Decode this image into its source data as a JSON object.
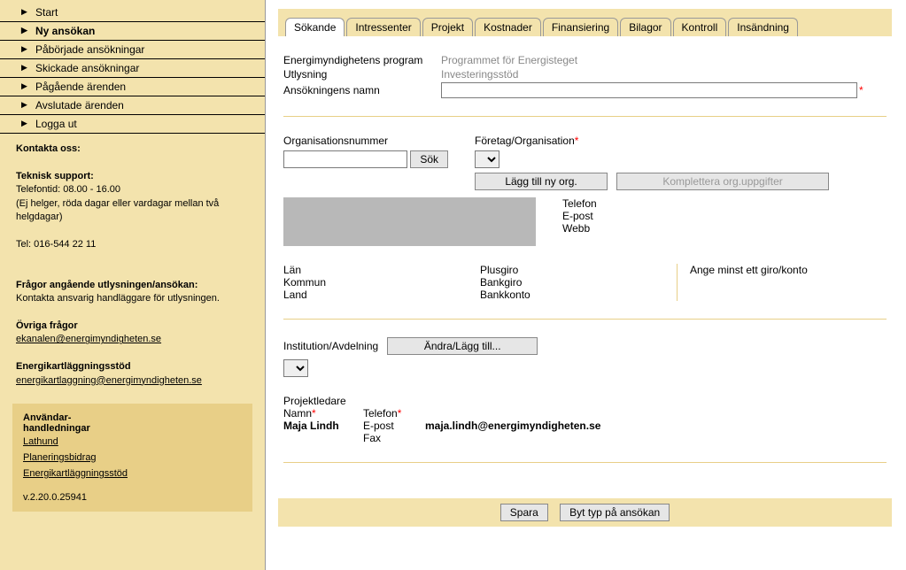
{
  "nav": {
    "items": [
      {
        "label": "Start"
      },
      {
        "label": "Ny ansökan",
        "active": true
      },
      {
        "label": "Påbörjade ansökningar"
      },
      {
        "label": "Skickade ansökningar"
      },
      {
        "label": "Pågående ärenden"
      },
      {
        "label": "Avslutade ärenden"
      },
      {
        "label": "Logga ut"
      }
    ]
  },
  "contact": {
    "heading": "Kontakta oss:",
    "tech_title": "Teknisk support:",
    "tech_hours": "Telefontid: 08.00 - 16.00",
    "tech_note": "(Ej helger, röda dagar eller vardagar mellan två helgdagar)",
    "tech_phone": "Tel: 016-544 22 11",
    "q_title": "Frågor angående utlysningen/ansökan:",
    "q_text": "Kontakta ansvarig handläggare för utlysningen.",
    "other_title": "Övriga frågor",
    "other_email": "ekanalen@energimyndigheten.se",
    "ek_title": "Energikartläggningsstöd",
    "ek_email": "energikartlaggning@energimyndigheten.se"
  },
  "guides": {
    "title1": "Användar-",
    "title2": "handledningar",
    "links": [
      "Lathund",
      "Planeringsbidrag",
      "Energikartläggningsstöd"
    ],
    "version": "v.2.20.0.25941"
  },
  "tabs": [
    "Sökande",
    "Intressenter",
    "Projekt",
    "Kostnader",
    "Finansiering",
    "Bilagor",
    "Kontroll",
    "Insändning"
  ],
  "active_tab": "Sökande",
  "form": {
    "program_label": "Energimyndighetens program",
    "program_value": "Programmet för Energisteget",
    "call_label": "Utlysning",
    "call_value": "Investeringsstöd",
    "appname_label": "Ansökningens namn",
    "orgnum_label": "Organisationsnummer",
    "search_btn": "Sök",
    "company_label": "Företag/Organisation",
    "add_org_btn": "Lägg till ny org.",
    "complete_org_btn": "Komplettera org.uppgifter",
    "phone_label": "Telefon",
    "email_label": "E-post",
    "web_label": "Webb",
    "county_label": "Län",
    "municipality_label": "Kommun",
    "country_label": "Land",
    "plusgiro_label": "Plusgiro",
    "bankgiro_label": "Bankgiro",
    "bankaccount_label": "Bankkonto",
    "giro_note": "Ange minst ett giro/konto",
    "institution_label": "Institution/Avdelning",
    "edit_add_btn": "Ändra/Lägg till...",
    "pl_heading": "Projektledare",
    "pl_name_label": "Namn",
    "pl_phone_label": "Telefon",
    "pl_email_label": "E-post",
    "pl_fax_label": "Fax",
    "pl_name_value": "Maja Lindh",
    "pl_email_value": "maja.lindh@energimyndigheten.se",
    "save_btn": "Spara",
    "change_type_btn": "Byt typ på ansökan"
  }
}
